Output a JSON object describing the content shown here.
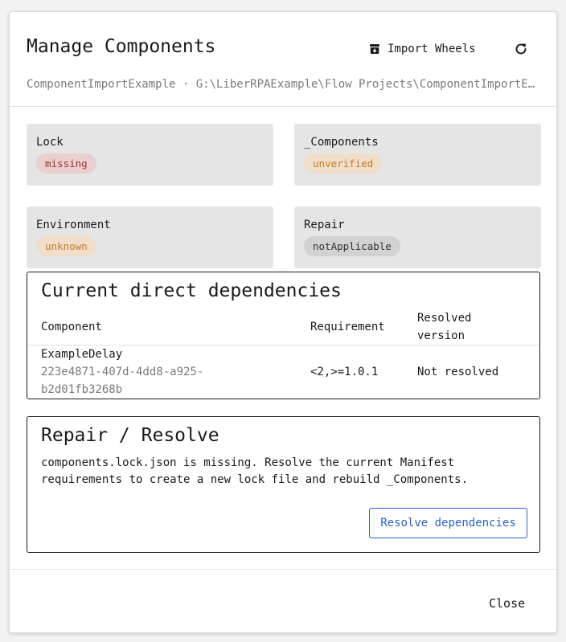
{
  "dialog": {
    "title": "Manage Components",
    "import_label": "Import Wheels",
    "import_icon": "archive-icon",
    "refresh_icon": "refresh-icon",
    "subtitle": "ComponentImportExample · G:\\LiberRPAExample\\Flow Projects\\ComponentImportExample"
  },
  "status_cards": [
    {
      "label": "Lock",
      "status": "missing",
      "status_color": "#a33030"
    },
    {
      "label": "_Components",
      "status": "unverified",
      "status_color": "#c57d28"
    },
    {
      "label": "Environment",
      "status": "unknown",
      "status_color": "#c57d28"
    },
    {
      "label": "Repair",
      "status": "notApplicable",
      "status_color": "#333333"
    }
  ],
  "dependencies": {
    "title": "Current direct dependencies",
    "headers": {
      "component": "Component",
      "requirement": "Requirement",
      "resolved_line1": "Resolved",
      "resolved_line2": "version"
    },
    "rows": [
      {
        "name": "ExampleDelay",
        "id_line1": "223e4871-407d-4dd8-a925-",
        "id_line2": "b2d01fb3268b",
        "requirement": "<2,>=1.0.1",
        "resolved": "Not resolved"
      }
    ]
  },
  "repair": {
    "title": "Repair / Resolve",
    "line1": "components.lock.json is missing. Resolve the current Manifest",
    "line2": "requirements to create a new lock file and rebuild _Components.",
    "button_label": "Resolve dependencies",
    "button_color": "#2a64c0"
  },
  "footer": {
    "close_label": "Close"
  }
}
